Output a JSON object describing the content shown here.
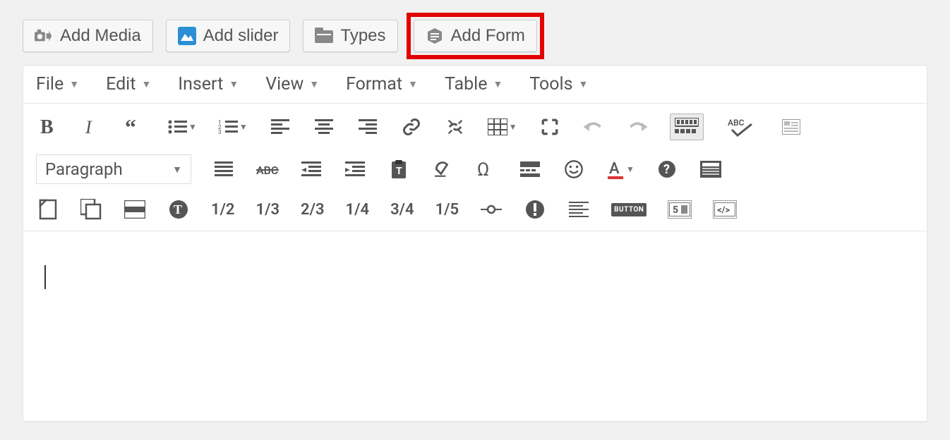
{
  "media_buttons": {
    "add_media": "Add Media",
    "add_slider": "Add slider",
    "types": "Types",
    "add_form": "Add Form"
  },
  "menubar": {
    "file": "File",
    "edit": "Edit",
    "insert": "Insert",
    "view": "View",
    "format": "Format",
    "table": "Table",
    "tools": "Tools"
  },
  "paragraph_label": "Paragraph",
  "fractions": {
    "half": "1/2",
    "third": "1/3",
    "twothirds": "2/3",
    "quarter": "1/4",
    "threequarters": "3/4",
    "fifth": "1/5"
  },
  "button_badge": "BUTTON",
  "five_badge": "5",
  "abc_label": "ABC"
}
